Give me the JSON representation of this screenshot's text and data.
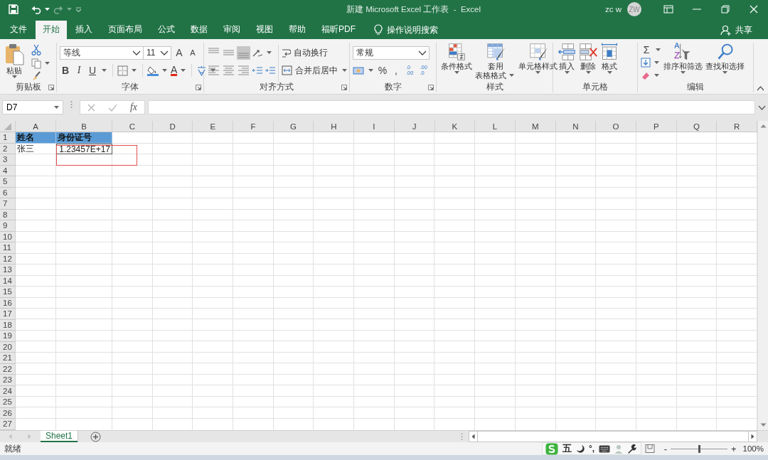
{
  "window": {
    "title": "新建 Microsoft Excel 工作表  -  Excel",
    "user": "zc w",
    "avatar": "ZW"
  },
  "tabs": [
    {
      "label": "文件",
      "selected": false
    },
    {
      "label": "开始",
      "selected": true
    },
    {
      "label": "插入",
      "selected": false
    },
    {
      "label": "页面布局",
      "selected": false
    },
    {
      "label": "公式",
      "selected": false
    },
    {
      "label": "数据",
      "selected": false
    },
    {
      "label": "审阅",
      "selected": false
    },
    {
      "label": "视图",
      "selected": false
    },
    {
      "label": "帮助",
      "selected": false
    },
    {
      "label": "福昕PDF",
      "selected": false
    }
  ],
  "tell_me": "操作说明搜索",
  "share": "共享",
  "ribbon": [
    {
      "kind": "clipboard",
      "label": "剪贴板",
      "paste": "粘贴"
    },
    {
      "kind": "font",
      "label": "字体",
      "font_name": "等线",
      "font_size": "11",
      "grow": "A",
      "shrink": "A",
      "styles": [
        "B",
        "I",
        "U"
      ],
      "font_color": "A"
    },
    {
      "kind": "alignment",
      "label": "对齐方式",
      "vertical_alignment": [
        {
          "selected": false
        },
        {
          "selected": false
        },
        {
          "selected": true
        }
      ],
      "horizontal_alignment": [
        {
          "selected": false
        },
        {
          "selected": false
        },
        {
          "selected": false
        }
      ],
      "wrap_text": "自动换行",
      "merge": "合并后居中"
    },
    {
      "kind": "number",
      "label": "数字",
      "format": "常规",
      "percent": "%",
      "comma": ",",
      "decimal_buttons": [
        {
          "top": ".0",
          "bottom": ".00"
        },
        {
          "top": ".00",
          "bottom": ".0"
        }
      ]
    },
    {
      "kind": "buttons",
      "label": "样式",
      "buttons": [
        {
          "kind": "conditional",
          "lines": [
            "条件格式"
          ]
        },
        {
          "kind": "table",
          "lines": [
            "套用",
            "表格格式"
          ]
        },
        {
          "kind": "cell_style",
          "lines": [
            "单元格样式"
          ]
        }
      ]
    },
    {
      "kind": "buttons",
      "label": "单元格",
      "buttons": [
        {
          "kind": "insert",
          "lines": [
            "插入"
          ]
        },
        {
          "kind": "delete",
          "lines": [
            "删除"
          ]
        },
        {
          "kind": "format",
          "lines": [
            "格式"
          ]
        }
      ]
    },
    {
      "kind": "editing",
      "label": "编辑",
      "sum": "Σ",
      "buttons": [
        {
          "kind": "sort",
          "lines": [
            "排序和筛选"
          ]
        },
        {
          "kind": "find",
          "lines": [
            "查找和选择"
          ]
        }
      ]
    }
  ],
  "formula_bar": {
    "name_box": "D7",
    "function_label": "fx"
  },
  "sheet": {
    "columns": [
      "A",
      "B",
      "C",
      "D",
      "E",
      "F",
      "G",
      "H",
      "I",
      "J",
      "K",
      "L",
      "M",
      "N",
      "O",
      "P",
      "Q",
      "R"
    ],
    "rows": [
      {
        "label": "1",
        "cells": [
          {
            "text": "姓名",
            "kind": "header"
          },
          {
            "text": "身份证号",
            "kind": "header"
          }
        ]
      },
      {
        "label": "2",
        "cells": [
          {
            "text": "张三",
            "kind": "text"
          },
          {
            "text": "1.23457E+17",
            "kind": "number"
          }
        ]
      },
      {
        "label": "3"
      },
      {
        "label": "4"
      },
      {
        "label": "5"
      },
      {
        "label": "6"
      },
      {
        "label": "7"
      },
      {
        "label": "8"
      },
      {
        "label": "9"
      },
      {
        "label": "10"
      },
      {
        "label": "11"
      },
      {
        "label": "12"
      },
      {
        "label": "13"
      },
      {
        "label": "14"
      },
      {
        "label": "15"
      },
      {
        "label": "16"
      },
      {
        "label": "17"
      },
      {
        "label": "18"
      },
      {
        "label": "19"
      },
      {
        "label": "20"
      },
      {
        "label": "21"
      },
      {
        "label": "22"
      },
      {
        "label": "23"
      },
      {
        "label": "24"
      },
      {
        "label": "25"
      },
      {
        "label": "26"
      },
      {
        "label": "27"
      }
    ]
  },
  "sheet_tabs": [
    {
      "label": "Sheet1",
      "selected": true
    }
  ],
  "status_bar": {
    "text": "就绪",
    "zoom_out": "-",
    "zoom_in": "+",
    "zoom_slider": {
      "level": 0.5
    },
    "zoom": "100%"
  },
  "ime_toolbar": {
    "mode": "五",
    "punctuation": "°,"
  }
}
